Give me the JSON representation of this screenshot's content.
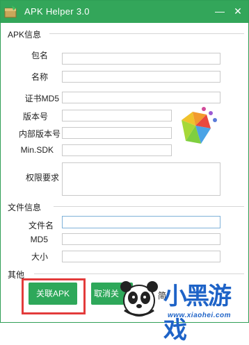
{
  "window": {
    "title": "APK Helper 3.0",
    "accent": "#33a65a",
    "controls": {
      "minimize": "—",
      "close": "✕"
    }
  },
  "apk_info": {
    "section_title": "APK信息",
    "fields": [
      {
        "key": "package",
        "label": "包名",
        "value": ""
      },
      {
        "key": "name",
        "label": "名称",
        "value": ""
      },
      {
        "key": "cert_md5",
        "label": "证书MD5",
        "value": ""
      },
      {
        "key": "version",
        "label": "版本号",
        "value": ""
      },
      {
        "key": "internal_version",
        "label": "内部版本号",
        "value": ""
      },
      {
        "key": "min_sdk",
        "label": "Min.SDK",
        "value": ""
      },
      {
        "key": "permissions",
        "label": "权限要求",
        "value": ""
      }
    ]
  },
  "file_info": {
    "section_title": "文件信息",
    "fields": [
      {
        "key": "filename",
        "label": "文件名",
        "value": ""
      },
      {
        "key": "md5",
        "label": "MD5",
        "value": ""
      },
      {
        "key": "size",
        "label": "大小",
        "value": ""
      }
    ]
  },
  "other": {
    "section_title": "其他",
    "associate_label": "关联APK",
    "cancel_label": "取消关",
    "partial_label": "简"
  },
  "watermark": {
    "text": "小黑游戏",
    "url": "www.xiaohei.com"
  },
  "icons": [
    "app-box-icon",
    "minimize-icon",
    "close-icon",
    "apk-logo-icon",
    "panda-mascot-icon"
  ]
}
